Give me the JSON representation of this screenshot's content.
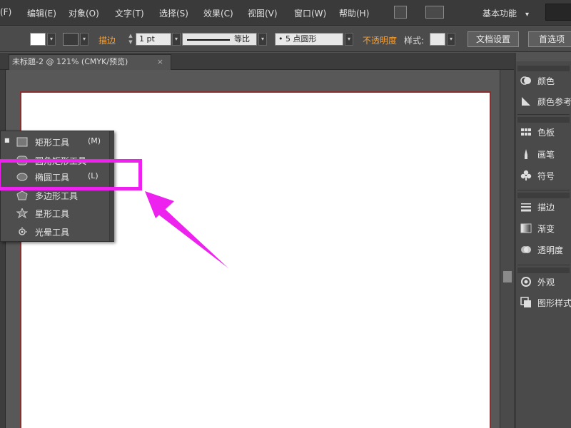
{
  "menubar": {
    "items": [
      {
        "label": "(F)"
      },
      {
        "label": "编辑(E)"
      },
      {
        "label": "对象(O)"
      },
      {
        "label": "文字(T)"
      },
      {
        "label": "选择(S)"
      },
      {
        "label": "效果(C)"
      },
      {
        "label": "视图(V)"
      },
      {
        "label": "窗口(W)"
      },
      {
        "label": "帮助(H)"
      }
    ],
    "workspace_label": "基本功能",
    "workspace_arrow": "▾"
  },
  "controlbar": {
    "stroke_label": "描边",
    "stroke_weight": "1 pt",
    "line_style": "等比",
    "brush": "• 5 点圆形",
    "opacity_label": "不透明度",
    "style_label": "样式:",
    "doc_settings": "文档设置",
    "preferences": "首选项",
    "dropdown_arrow": "▾"
  },
  "tab": {
    "title": "未标题-2 @ 121% (CMYK/预览)",
    "close": "×"
  },
  "flyout": {
    "items": [
      {
        "label": "矩形工具",
        "shortcut": "(M)",
        "icon": "rectangle-icon",
        "bullet": "■"
      },
      {
        "label": "圆角矩形工具",
        "shortcut": "",
        "icon": "rounded-rectangle-icon",
        "bullet": ""
      },
      {
        "label": "椭圆工具",
        "shortcut": "(L)",
        "icon": "ellipse-icon",
        "bullet": ""
      },
      {
        "label": "多边形工具",
        "shortcut": "",
        "icon": "polygon-icon",
        "bullet": ""
      },
      {
        "label": "星形工具",
        "shortcut": "",
        "icon": "star-icon",
        "bullet": ""
      },
      {
        "label": "光晕工具",
        "shortcut": "",
        "icon": "flare-icon",
        "bullet": ""
      }
    ]
  },
  "panels": {
    "items": [
      {
        "label": "颜色",
        "icon": "color-icon"
      },
      {
        "label": "颜色参考",
        "icon": "color-guide-icon"
      },
      {
        "label": "色板",
        "icon": "swatches-icon"
      },
      {
        "label": "画笔",
        "icon": "brushes-icon"
      },
      {
        "label": "符号",
        "icon": "symbols-icon"
      },
      {
        "label": "描边",
        "icon": "stroke-icon"
      },
      {
        "label": "渐变",
        "icon": "gradient-icon"
      },
      {
        "label": "透明度",
        "icon": "transparency-icon"
      },
      {
        "label": "外观",
        "icon": "appearance-icon"
      },
      {
        "label": "图形样式",
        "icon": "graphic-styles-icon"
      }
    ]
  },
  "colors": {
    "annotation": "#ee22ee",
    "accent_orange": "#f4a13a",
    "artboard_border": "#8b2e2e"
  }
}
